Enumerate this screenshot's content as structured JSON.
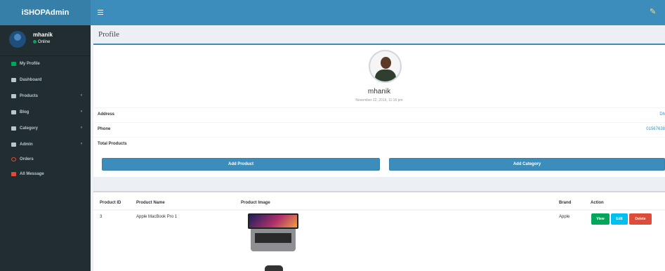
{
  "brand": "iSHOPAdmin",
  "user": {
    "name": "mhanik",
    "status": "Online"
  },
  "menu": [
    {
      "label": "My Profile",
      "icon": "user-icon",
      "color": "#00a65a",
      "has_children": false
    },
    {
      "label": "Dashboard",
      "icon": "dashboard-icon",
      "color": "#b8c7ce",
      "has_children": false
    },
    {
      "label": "Products",
      "icon": "list-icon",
      "color": "#b8c7ce",
      "has_children": true
    },
    {
      "label": "Blog",
      "icon": "list-icon",
      "color": "#b8c7ce",
      "has_children": true
    },
    {
      "label": "Category",
      "icon": "list-icon",
      "color": "#b8c7ce",
      "has_children": true
    },
    {
      "label": "Admin",
      "icon": "users-icon",
      "color": "#b8c7ce",
      "has_children": true
    },
    {
      "label": "Orders",
      "icon": "circle-icon",
      "color": "#dd4b39",
      "has_children": false
    },
    {
      "label": "All Message",
      "icon": "envelope-icon",
      "color": "#dd4b39",
      "has_children": false
    }
  ],
  "chevron": "‹",
  "page_title": "Profile",
  "profile": {
    "name": "mhanik",
    "date": "November 22, 2019, 11:16 pm",
    "rows": [
      {
        "label": "Address",
        "value": "Dh"
      },
      {
        "label": "Phone",
        "value": "01567638"
      },
      {
        "label": "Total Products",
        "value": ""
      }
    ],
    "buttons": {
      "add_product": "Add Product",
      "add_category": "Add Category"
    }
  },
  "table": {
    "headers": [
      "Product ID",
      "Product Name",
      "Product Image",
      "Brand",
      "Action"
    ],
    "rows": [
      {
        "id": "3",
        "name": "Apple MacBook Pro 1",
        "brand": "Apple"
      }
    ],
    "actions": {
      "view": "View",
      "edit": "Edit",
      "delete": "Delete",
      "view_color": "#00a65a",
      "edit_color": "#00c0ef",
      "delete_color": "#dd4b39"
    }
  },
  "colors": {
    "header": "#3c8dbc",
    "header_dark": "#367fa9",
    "sidebar": "#222d32"
  }
}
